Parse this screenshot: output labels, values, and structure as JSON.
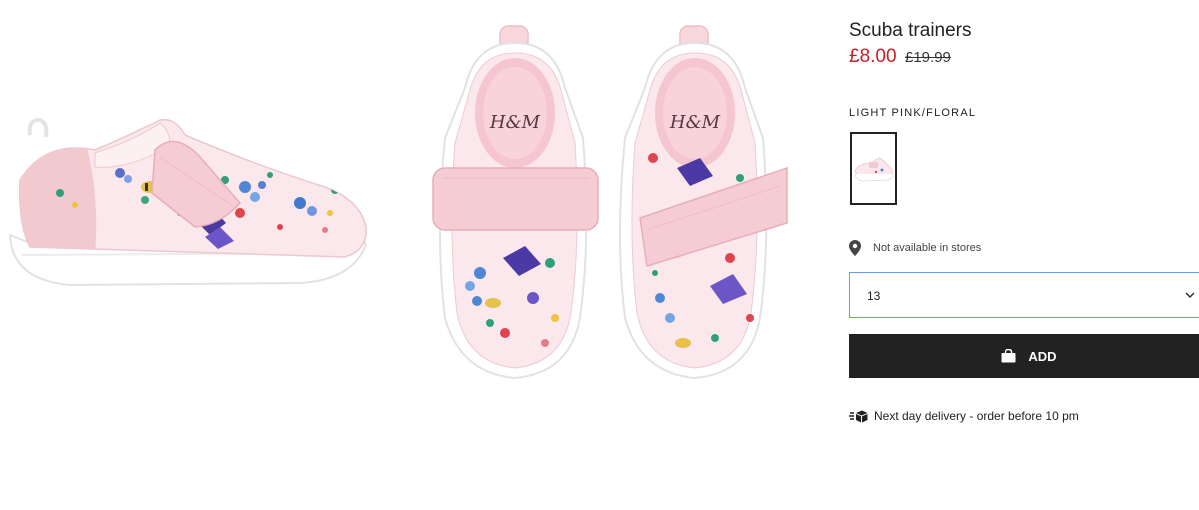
{
  "product": {
    "title": "Scuba trainers",
    "price": "£8.00",
    "original_price": "£19.99",
    "color_label": "LIGHT PINK/FLORAL",
    "availability_text": "Not available in stores",
    "size_selected": "13",
    "add_label": "ADD",
    "delivery_text": "Next day delivery - order before 10 pm",
    "brand_mark": "H&M"
  },
  "colors": {
    "sale": "#c2212a",
    "button": "#222222",
    "select_border": "#6a9be3",
    "shoe_pink": "#f4c8d0"
  },
  "icons": [
    "location-pin-icon",
    "chevron-down-icon",
    "shopping-bag-icon",
    "delivery-truck-icon"
  ]
}
